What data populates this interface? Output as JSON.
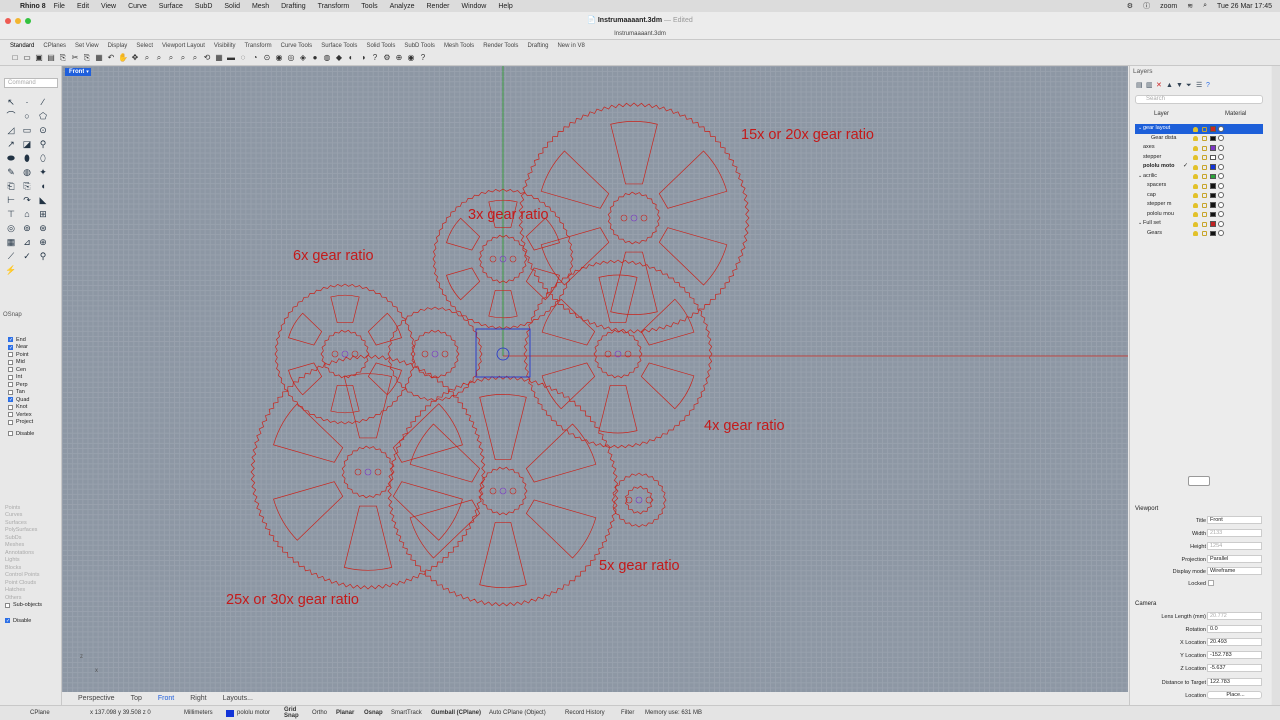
{
  "menubar": {
    "app": "Rhino 8",
    "items": [
      "File",
      "Edit",
      "View",
      "Curve",
      "Surface",
      "SubD",
      "Solid",
      "Mesh",
      "Drafting",
      "Transform",
      "Tools",
      "Analyze",
      "Render",
      "Window",
      "Help"
    ],
    "zoom": "zoom",
    "clock": "Tue 26 Mar  17:45"
  },
  "window": {
    "title": "Instrumaaaant.3dm",
    "edited": "— Edited",
    "subtitle": "Instrumaaaant.3dm"
  },
  "tabs": [
    "Standard",
    "CPlanes",
    "Set View",
    "Display",
    "Select",
    "Viewport Layout",
    "Visibility",
    "Transform",
    "Curve Tools",
    "Surface Tools",
    "Solid Tools",
    "SubD Tools",
    "Mesh Tools",
    "Render Tools",
    "Drafting",
    "New in V8"
  ],
  "command": {
    "placeholder": "Command"
  },
  "osnap": {
    "title": "OSnap",
    "items": [
      {
        "label": "End",
        "on": true
      },
      {
        "label": "Near",
        "on": true
      },
      {
        "label": "Point",
        "on": false
      },
      {
        "label": "Mid",
        "on": false
      },
      {
        "label": "Cen",
        "on": false
      },
      {
        "label": "Int",
        "on": false
      },
      {
        "label": "Perp",
        "on": false
      },
      {
        "label": "Tan",
        "on": false
      },
      {
        "label": "Quad",
        "on": true
      },
      {
        "label": "Knot",
        "on": false
      },
      {
        "label": "Vertex",
        "on": false
      },
      {
        "label": "Project",
        "on": false
      }
    ],
    "disable": "Disable"
  },
  "selection_filter": {
    "items": [
      "Points",
      "Curves",
      "Surfaces",
      "PolySurfaces",
      "SubDs",
      "Meshes",
      "Annotations",
      "Lights",
      "Blocks",
      "Control Points",
      "Point Clouds",
      "Hatches",
      "Others"
    ],
    "subobjects": "Sub-objects",
    "disable": "Disable"
  },
  "viewport": {
    "name": "Front",
    "labels": {
      "l15": "15x or 20x gear ratio",
      "l3": "3x gear ratio",
      "l6": "6x gear ratio",
      "l4": "4x gear ratio",
      "l5": "5x gear ratio",
      "l25": "25x or 30x gear ratio"
    },
    "axis": {
      "z": "z",
      "x": "x"
    }
  },
  "view_tabs": [
    "Perspective",
    "Top",
    "Front",
    "Right",
    "Layouts..."
  ],
  "active_view": "Front",
  "layers": {
    "title": "Layers",
    "search_placeholder": "Search",
    "col_layer": "Layer",
    "col_material": "Material",
    "rows": [
      {
        "name": "gear layout",
        "color": "#d0281c",
        "selected": true,
        "expanded": true,
        "indent": 1
      },
      {
        "name": "Gear dista",
        "color": "#111111",
        "indent": 3
      },
      {
        "name": "axes",
        "color": "#7b35c4",
        "indent": 1
      },
      {
        "name": "stepper",
        "color": "#ffffff",
        "indent": 1
      },
      {
        "name": "pololu moto",
        "color": "#1234d8",
        "indent": 1,
        "current": true,
        "check": "✓"
      },
      {
        "name": "acrilic",
        "color": "#2aa43a",
        "indent": 1,
        "expanded": true
      },
      {
        "name": "spacers",
        "color": "#111111",
        "indent": 2
      },
      {
        "name": "cap",
        "color": "#111111",
        "indent": 2
      },
      {
        "name": "stepper m",
        "color": "#111111",
        "indent": 2
      },
      {
        "name": "pololu mou",
        "color": "#111111",
        "indent": 2
      },
      {
        "name": "Full set",
        "color": "#c02020",
        "indent": 1,
        "expanded": true
      },
      {
        "name": "Gears",
        "color": "#111111",
        "indent": 2
      }
    ]
  },
  "properties": {
    "viewport_section": "Viewport",
    "title_label": "Title",
    "title_value": "Front",
    "width_label": "Width",
    "width_value": "2133",
    "height_label": "Height",
    "height_value": "1254",
    "projection_label": "Projection",
    "projection_value": "Parallel",
    "display_label": "Display mode",
    "display_value": "Wireframe",
    "locked_label": "Locked",
    "camera_section": "Camera",
    "lens_label": "Lens Length (mm)",
    "lens_value": "20.772",
    "rotation_label": "Rotation",
    "rotation_value": "0.0",
    "xloc_label": "X Location",
    "xloc_value": "20.493",
    "yloc_label": "Y Location",
    "yloc_value": "-152.783",
    "zloc_label": "Z Location",
    "zloc_value": "-5.637",
    "dist_label": "Distance to Target",
    "dist_value": "122.783",
    "location_label": "Location",
    "place_button": "Place..."
  },
  "status": {
    "cplane": "CPlane",
    "coords": "x 137.098  y 39.508  z 0",
    "units": "Millimeters",
    "layer": "pololu motor",
    "layer_color": "#1234d8",
    "grid_snap": "Grid Snap",
    "ortho": "Ortho",
    "planar": "Planar",
    "osnap": "Osnap",
    "smarttrack": "SmartTrack",
    "gumball": "Gumball (CPlane)",
    "auto_cplane": "Auto CPlane (Object)",
    "record": "Record History",
    "filter": "Filter",
    "memory": "Memory use: 631 MB"
  }
}
